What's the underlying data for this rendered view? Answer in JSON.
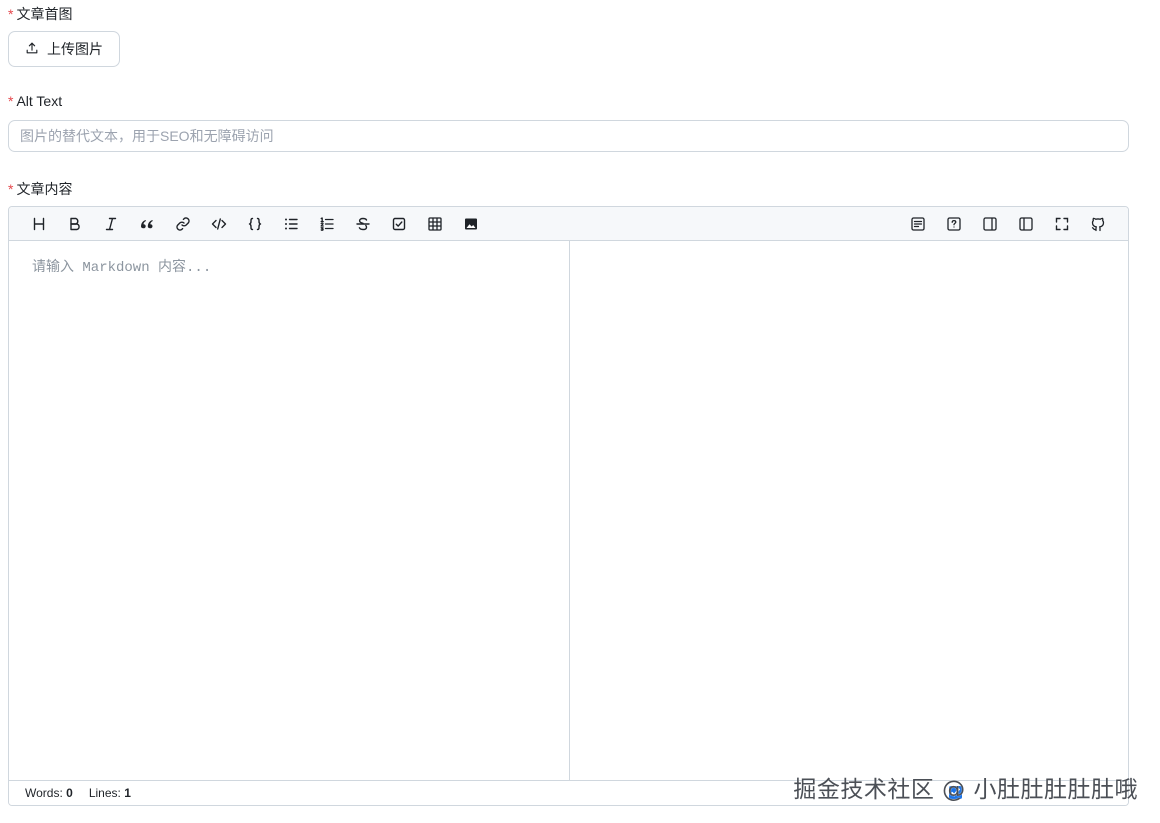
{
  "fields": {
    "cover": {
      "required_mark": "*",
      "label": "文章首图"
    },
    "alt": {
      "required_mark": "*",
      "label": "Alt Text",
      "placeholder": "图片的替代文本，用于SEO和无障碍访问",
      "value": ""
    },
    "content": {
      "required_mark": "*",
      "label": "文章内容"
    }
  },
  "upload": {
    "label": "上传图片",
    "icon": "upload-icon"
  },
  "editor": {
    "placeholder": "请输入 Markdown 内容...",
    "toolbar_left": [
      "heading-icon",
      "bold-icon",
      "italic-icon",
      "quote-icon",
      "link-icon",
      "code-icon",
      "code-block-icon",
      "unordered-list-icon",
      "ordered-list-icon",
      "strikethrough-icon",
      "task-list-icon",
      "table-icon",
      "image-icon"
    ],
    "toolbar_right": [
      "write-icon",
      "help-icon",
      "preview-only-icon",
      "editor-only-icon",
      "fullscreen-icon",
      "github-icon"
    ],
    "status": {
      "words_label": "Words:",
      "words": "0",
      "lines_label": "Lines:",
      "lines": "1",
      "sync_checked": true
    }
  },
  "watermark": "掘金技术社区 @ 小肚肚肚肚肚哦"
}
